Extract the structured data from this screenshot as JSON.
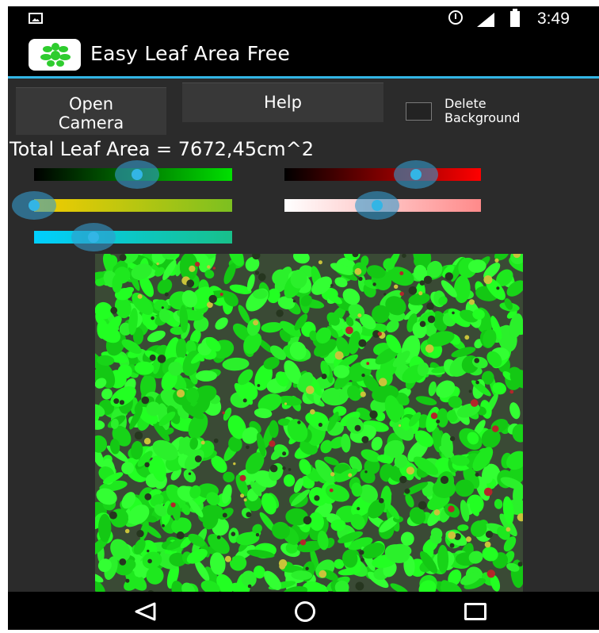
{
  "status_bar": {
    "time": "3:49",
    "icons": [
      "gallery-notification-icon",
      "alarm-icon",
      "signal-icon",
      "battery-icon"
    ]
  },
  "action_bar": {
    "title": "Easy Leaf Area Free",
    "app_icon": "leaf-app-icon"
  },
  "controls": {
    "open_camera_label": "Open\nCamera",
    "help_label": "Help",
    "delete_background_label": "Delete\nBackground",
    "delete_background_checked": false
  },
  "result": {
    "total_leaf_area_text": "Total Leaf Area = 7672,45cm^2"
  },
  "sliders": [
    {
      "name": "green-threshold",
      "gradient": [
        "#000000",
        "#00e000"
      ],
      "level": 0.52
    },
    {
      "name": "red-threshold",
      "gradient": [
        "#000000",
        "#ff0000"
      ],
      "level": 0.67
    },
    {
      "name": "yellow-green-ratio",
      "gradient": [
        "#f5cc00",
        "#7cc020"
      ],
      "level": 0.0
    },
    {
      "name": "white-red-threshold",
      "gradient": [
        "#ffffff",
        "#ff8a8a"
      ],
      "level": 0.47
    },
    {
      "name": "blue-green-threshold",
      "gradient": [
        "#00cfff",
        "#18c08a"
      ],
      "level": 0.3
    }
  ],
  "colors": {
    "accent": "#33b5e5",
    "leaf_highlight": "#22ff22",
    "background": "#2b2b2b"
  },
  "nav_bar": {
    "icons": [
      "back-icon",
      "home-icon",
      "recent-apps-icon"
    ]
  }
}
